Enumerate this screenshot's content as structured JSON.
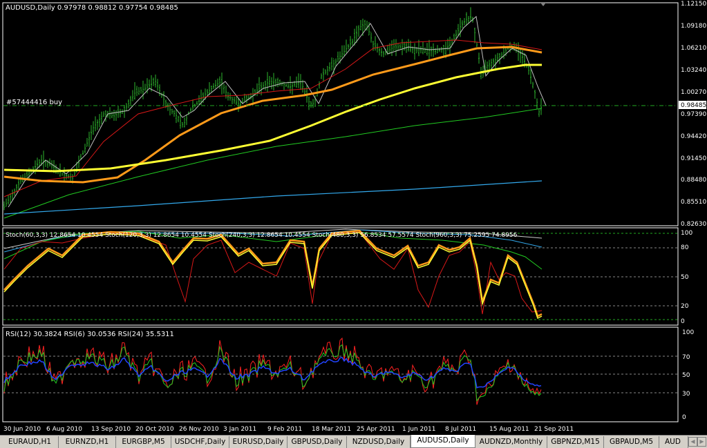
{
  "main_chart": {
    "header": "AUDUSD,Daily  0.97978 0.98812 0.97754 0.98485",
    "order_label": "#57444416 buy",
    "current_price": "0.98485",
    "price_ticks": [
      "1.12150",
      "1.09180",
      "1.06210",
      "1.03240",
      "1.00270",
      "0.97390",
      "0.94420",
      "0.91450",
      "0.88480",
      "0.85510",
      "0.82630"
    ]
  },
  "stoch_panel": {
    "header": "Stoch(60,3,3) 12.8654 10.4554  Stoch(120,3,3) 12.8654 10.4554  Stoch(240,3,3) 12.8654 10.4554  Stoch(480,3,3) 56.8534 57.5574  Stoch(960,3,3) 75.2595 74.8956",
    "levels": [
      "100",
      "80",
      "50",
      "20",
      "0"
    ]
  },
  "rsi_panel": {
    "header": "RSI(12) 30.3824  RSI(6) 30.0536  RSI(24) 35.5311",
    "levels": [
      "100",
      "70",
      "50",
      "30",
      "0"
    ]
  },
  "date_axis": [
    "30 Jun 2010",
    "6 Aug 2010",
    "13 Sep 2010",
    "20 Oct 2010",
    "26 Nov 2010",
    "3 Jan 2011",
    "9 Feb 2011",
    "18 Mar 2011",
    "25 Apr 2011",
    "1 Jun 2011",
    "8 Jul 2011",
    "15 Aug 2011",
    "21 Sep 2011"
  ],
  "tabs": [
    {
      "label": "EURAUD,H1",
      "active": false
    },
    {
      "label": "EURNZD,H1",
      "active": false
    },
    {
      "label": "EURGBP,M5",
      "active": false
    },
    {
      "label": "USDCHF,Daily",
      "active": false
    },
    {
      "label": "EURUSD,Daily",
      "active": false
    },
    {
      "label": "GBPUSD,Daily",
      "active": false
    },
    {
      "label": "NZDUSD,Daily",
      "active": false
    },
    {
      "label": "AUDUSD,Daily",
      "active": true
    },
    {
      "label": "AUDNZD,Monthly",
      "active": false
    },
    {
      "label": "GBPNZD,M15",
      "active": false
    },
    {
      "label": "GBPAUD,M5",
      "active": false
    },
    {
      "label": "AUD",
      "active": false
    }
  ],
  "colors": {
    "bars": "#2eb82e",
    "ma_fast": "#c0c0c0",
    "ma_red": "#d81818",
    "ma_orange": "#ff9a1a",
    "ma_yellow": "#ffff33",
    "ma_green": "#22cc22",
    "ma_cyan": "#33aaee",
    "order_line": "#22aa22"
  },
  "icons": {
    "tab_scroll_left": "chevron-left-icon",
    "tab_scroll_right": "chevron-right-icon",
    "chart_shift_marker": "triangle-marker-icon"
  }
}
